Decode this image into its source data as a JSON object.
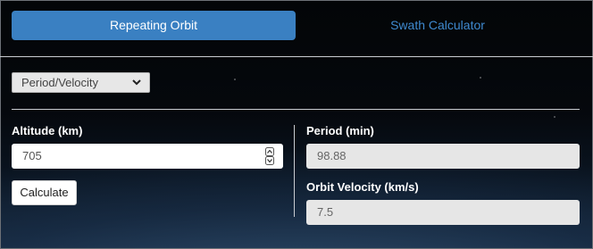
{
  "tabs": {
    "active_label": "Repeating Orbit",
    "inactive_label": "Swath Calculator"
  },
  "mode_select": {
    "selected": "Period/Velocity",
    "icon": "chevron-down-icon"
  },
  "altitude": {
    "label": "Altitude (km)",
    "value": "705"
  },
  "calculate_button": {
    "label": "Calculate"
  },
  "period": {
    "label": "Period (min)",
    "value": "98.88"
  },
  "orbit_velocity": {
    "label": "Orbit Velocity (km/s)",
    "value": "7.5"
  },
  "colors": {
    "accent": "#3a80c2",
    "link": "#3f8ad0"
  }
}
